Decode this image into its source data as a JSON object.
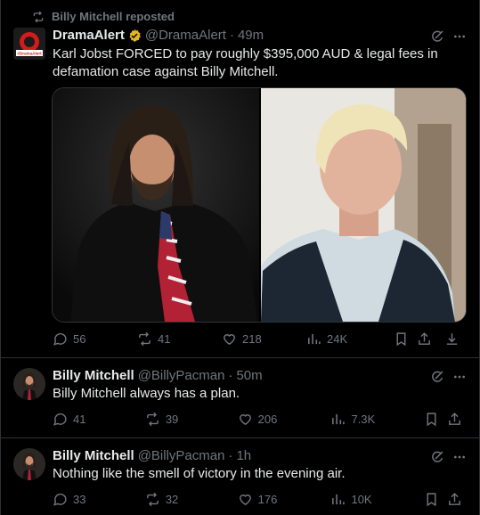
{
  "repost_banner": {
    "text": "Billy Mitchell reposted"
  },
  "tweets": [
    {
      "display_name": "DramaAlert",
      "handle": "@DramaAlert",
      "time": "49m",
      "verified": true,
      "avatar_text": "#DramaAlert",
      "text": "Karl Jobst FORCED to pay roughly $395,000 AUD & legal fees in defamation case against Billy Mitchell.",
      "replies": "56",
      "reposts": "41",
      "likes": "218",
      "views": "24K"
    },
    {
      "display_name": "Billy Mitchell",
      "handle": "@BillyPacman",
      "time": "50m",
      "text": "Billy Mitchell always has a plan.",
      "replies": "41",
      "reposts": "39",
      "likes": "206",
      "views": "7.3K"
    },
    {
      "display_name": "Billy Mitchell",
      "handle": "@BillyPacman",
      "time": "1h",
      "text": "Nothing like the smell of victory in the evening air.",
      "replies": "33",
      "reposts": "32",
      "likes": "176",
      "views": "10K"
    }
  ],
  "separator": "·",
  "colors": {
    "background": "#000000",
    "muted": "#71767b",
    "border": "#2f3336",
    "verified_gold": "#e2b719",
    "drama_red": "#d31b1b"
  }
}
